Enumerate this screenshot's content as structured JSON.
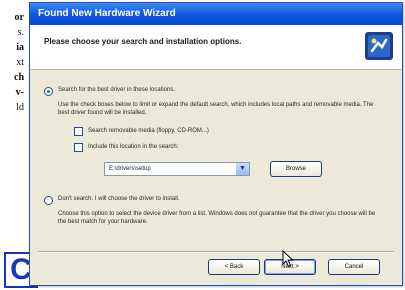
{
  "document": {
    "lines": [
      "or",
      "s.",
      "ia",
      "xt",
      "ch",
      "v-",
      "ld"
    ],
    "bold_lines": [
      0,
      2,
      4,
      5
    ],
    "figure_letter": "C"
  },
  "window": {
    "title": "Found New Hardware Wizard",
    "header_title": "Please choose your search and installation options.",
    "icon": "hardware-wizard-icon",
    "options": {
      "search_label": "Search for the best driver in these locations.",
      "search_desc": "Use the check boxes below to limit or expand the default search, which includes local paths and removable media. The best driver found will be installed.",
      "search_removable_label": "Search removable media (floppy, CD-ROM...)",
      "include_location_label": "Include this location in the search:",
      "location_value": "E:\\drivers\\setup",
      "browse_label": "Browse",
      "dont_search_label": "Don't search. I will choose the driver to install.",
      "dont_search_desc": "Choose this option to select the device driver from a list. Windows does not guarantee that the driver you choose will be the best match for your hardware."
    },
    "buttons": {
      "back": "< Back",
      "next": "Next >",
      "cancel": "Cancel"
    }
  },
  "colors": {
    "titlebar": "#0c55e0",
    "dialog_bg": "#ece9d8",
    "figure_letter": "#1a36b8"
  }
}
